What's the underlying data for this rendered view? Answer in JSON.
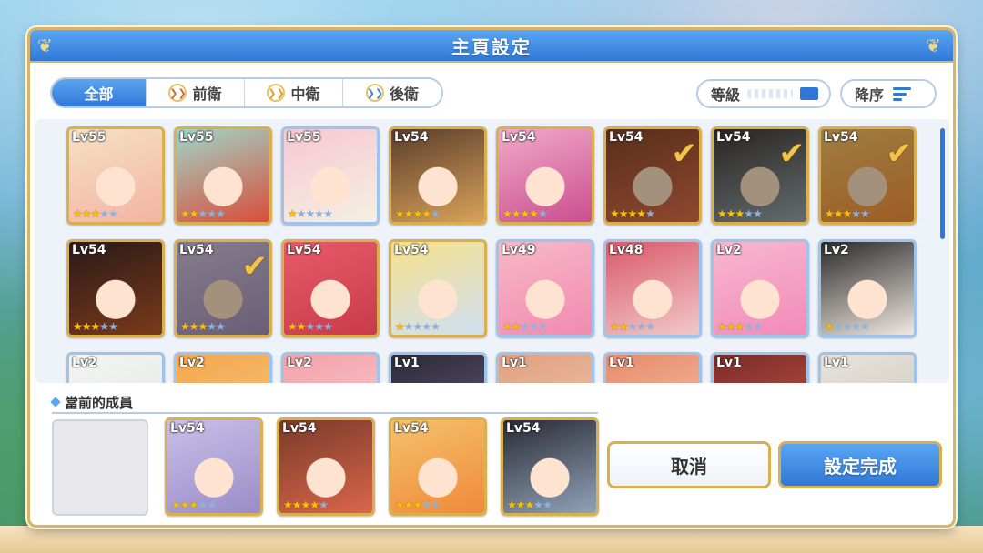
{
  "dialog": {
    "title": "主頁設定"
  },
  "filters": {
    "tabs": [
      {
        "label": "全部",
        "active": true
      },
      {
        "label": "前衛",
        "active": false
      },
      {
        "label": "中衛",
        "active": false
      },
      {
        "label": "後衛",
        "active": false
      }
    ]
  },
  "sort": {
    "level_label": "等級",
    "order_label": "降序"
  },
  "roster": {
    "rows": [
      [
        {
          "level": "Lv55",
          "stars": 3,
          "selected": false,
          "frame": "gold",
          "palette": [
            "#f5e1c4",
            "#f4b3a3"
          ]
        },
        {
          "level": "Lv55",
          "stars": 2,
          "selected": false,
          "frame": "gold",
          "palette": [
            "#9fd6c8",
            "#d94d3a"
          ]
        },
        {
          "level": "Lv55",
          "stars": 1,
          "selected": false,
          "frame": "blue",
          "palette": [
            "#f7c7d2",
            "#f4f0e3"
          ]
        },
        {
          "level": "Lv54",
          "stars": 4,
          "selected": false,
          "frame": "gold",
          "palette": [
            "#5a3d2b",
            "#d9a25a"
          ]
        },
        {
          "level": "Lv54",
          "stars": 4,
          "selected": false,
          "frame": "gold",
          "palette": [
            "#f2a9c8",
            "#c94f8f"
          ]
        },
        {
          "level": "Lv54",
          "stars": 4,
          "selected": true,
          "frame": "gold",
          "palette": [
            "#7a3a2a",
            "#d9664a"
          ]
        },
        {
          "level": "Lv54",
          "stars": 3,
          "selected": true,
          "frame": "gold",
          "palette": [
            "#2a2a33",
            "#8fa3b8"
          ]
        },
        {
          "level": "Lv54",
          "stars": 3,
          "selected": true,
          "frame": "gold",
          "palette": [
            "#f5c16a",
            "#f08a3a"
          ]
        }
      ],
      [
        {
          "level": "Lv54",
          "stars": 3,
          "selected": false,
          "frame": "gold",
          "palette": [
            "#2a1a18",
            "#7a3a1a"
          ]
        },
        {
          "level": "Lv54",
          "stars": 3,
          "selected": true,
          "frame": "gold",
          "palette": [
            "#c8c0e8",
            "#9a8cc8"
          ]
        },
        {
          "level": "Lv54",
          "stars": 2,
          "selected": false,
          "frame": "gold",
          "palette": [
            "#e85a6a",
            "#c93a4a"
          ]
        },
        {
          "level": "Lv54",
          "stars": 1,
          "selected": false,
          "frame": "gold",
          "palette": [
            "#f6e08a",
            "#cfe0f4"
          ]
        },
        {
          "level": "Lv49",
          "stars": 2,
          "selected": false,
          "frame": "blue",
          "palette": [
            "#f7b8c8",
            "#f28ab0"
          ]
        },
        {
          "level": "Lv48",
          "stars": 2,
          "selected": false,
          "frame": "blue",
          "palette": [
            "#d95a6a",
            "#f2c8c8"
          ]
        },
        {
          "level": "Lv2",
          "stars": 3,
          "selected": false,
          "frame": "blue",
          "palette": [
            "#f7b8d0",
            "#f28ab8"
          ]
        },
        {
          "level": "Lv2",
          "stars": 1,
          "selected": false,
          "frame": "blue",
          "palette": [
            "#2a2a2a",
            "#f0e8e0"
          ]
        }
      ],
      [
        {
          "level": "Lv2",
          "stars": 0,
          "selected": false,
          "frame": "blue",
          "palette": [
            "#f4f4f4",
            "#e0e8d8"
          ]
        },
        {
          "level": "Lv2",
          "stars": 0,
          "selected": false,
          "frame": "blue",
          "palette": [
            "#f5a64a",
            "#f2c88a"
          ]
        },
        {
          "level": "Lv2",
          "stars": 0,
          "selected": false,
          "frame": "blue",
          "palette": [
            "#f4a0a8",
            "#f8d0d4"
          ]
        },
        {
          "level": "Lv1",
          "stars": 0,
          "selected": false,
          "frame": "blue",
          "palette": [
            "#2a2a38",
            "#6a5a7a"
          ]
        },
        {
          "level": "Lv1",
          "stars": 0,
          "selected": false,
          "frame": "blue",
          "palette": [
            "#e0a080",
            "#f0c8b0"
          ]
        },
        {
          "level": "Lv1",
          "stars": 0,
          "selected": false,
          "frame": "blue",
          "palette": [
            "#e88a6a",
            "#f4c8b0"
          ]
        },
        {
          "level": "Lv1",
          "stars": 0,
          "selected": false,
          "frame": "blue",
          "palette": [
            "#7a2a2a",
            "#c85a4a"
          ]
        },
        {
          "level": "Lv1",
          "stars": 0,
          "selected": false,
          "frame": "blue",
          "palette": [
            "#e8e4dc",
            "#c8c4bc"
          ]
        }
      ]
    ]
  },
  "current": {
    "title": "當前的成員",
    "members": [
      {
        "level": "Lv54",
        "stars": 3,
        "palette": [
          "#c8c0e8",
          "#9a8cc8"
        ]
      },
      {
        "level": "Lv54",
        "stars": 4,
        "palette": [
          "#7a3a2a",
          "#d9664a"
        ]
      },
      {
        "level": "Lv54",
        "stars": 3,
        "palette": [
          "#f5c16a",
          "#f08a3a"
        ]
      },
      {
        "level": "Lv54",
        "stars": 3,
        "palette": [
          "#2a2a33",
          "#8fa3b8"
        ]
      }
    ]
  },
  "buttons": {
    "cancel": "取消",
    "confirm": "設定完成"
  },
  "colors": {
    "accent": "#2f78d8",
    "gold": "#d9b04f",
    "star": "#f6c20c"
  }
}
